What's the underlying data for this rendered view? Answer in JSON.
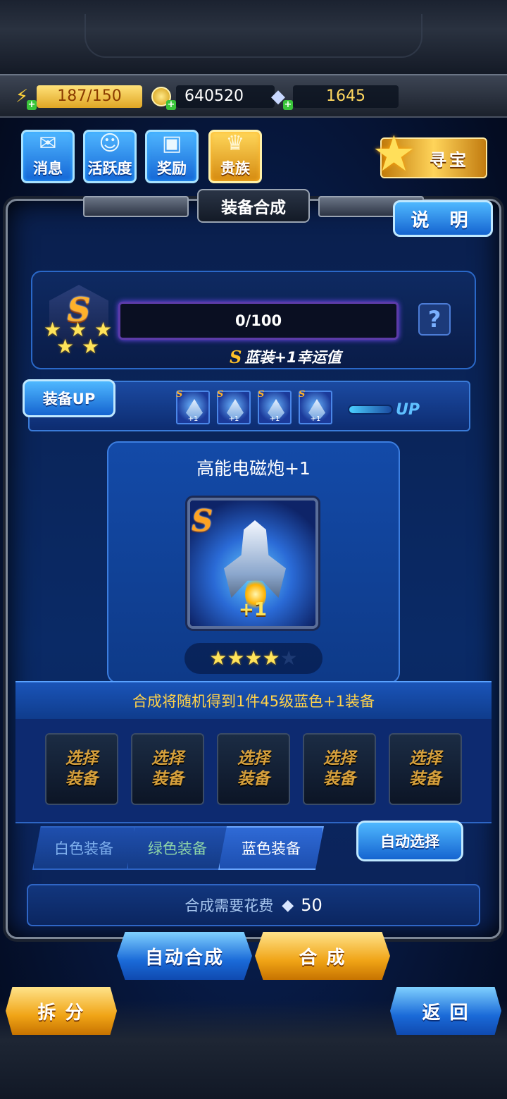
{
  "resources": {
    "energy": "187/150",
    "coins": "640520",
    "gems": "1645"
  },
  "top_buttons": [
    {
      "label": "消息",
      "icon": "mail-icon"
    },
    {
      "label": "活跃度",
      "icon": "smile-icon"
    },
    {
      "label": "奖励",
      "icon": "gift-icon"
    },
    {
      "label": "贵族",
      "icon": "vip-icon"
    }
  ],
  "treasure": {
    "label": "寻宝"
  },
  "panel": {
    "title": "装备合成",
    "explain": "说 明"
  },
  "luck": {
    "grade": "S",
    "stars": 5,
    "progress_text": "0/100",
    "progress_value": 0,
    "help": "?",
    "label_grade": "S",
    "label": "蓝装+1幸运值"
  },
  "equip_up": {
    "button": "装备UP",
    "items": [
      {
        "grade": "S",
        "plus": "+1"
      },
      {
        "grade": "S",
        "plus": "+1"
      },
      {
        "grade": "S",
        "plus": "+1"
      },
      {
        "grade": "S",
        "plus": "+1"
      }
    ],
    "indicator": "UP"
  },
  "item": {
    "name": "高能电磁炮+1",
    "grade": "S",
    "plus": "+1",
    "stars_filled": 4,
    "stars_total": 5
  },
  "merge_desc": "合成将随机得到1件45级蓝色+1装备",
  "slots": [
    {
      "line1": "选择",
      "line2": "装备"
    },
    {
      "line1": "选择",
      "line2": "装备"
    },
    {
      "line1": "选择",
      "line2": "装备"
    },
    {
      "line1": "选择",
      "line2": "装备"
    },
    {
      "line1": "选择",
      "line2": "装备"
    }
  ],
  "tabs": [
    {
      "label": "白色装备",
      "active": false,
      "color": "#7fb0ee"
    },
    {
      "label": "绿色装备",
      "active": false,
      "color": "#8fd6a8"
    },
    {
      "label": "蓝色装备",
      "active": true,
      "color": "#ffffff"
    }
  ],
  "auto_select": "自动选择",
  "cost": {
    "label": "合成需要花费",
    "value": "50"
  },
  "buttons": {
    "auto_merge": "自动合成",
    "merge": "合 成",
    "split": "拆 分",
    "back": "返 回"
  }
}
